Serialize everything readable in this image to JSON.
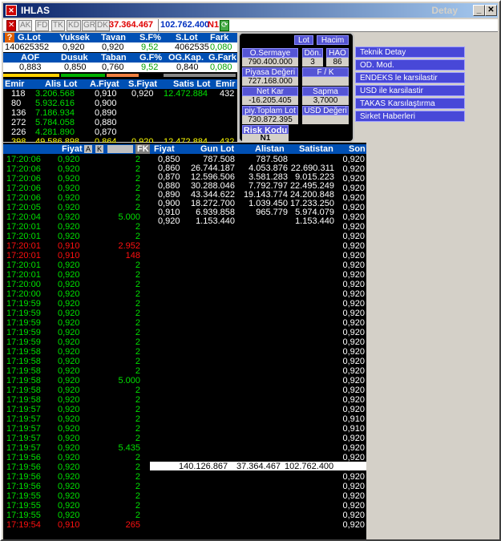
{
  "window": {
    "title": "IHLAS",
    "title_right": "Detay"
  },
  "toolbar": {
    "tabs": [
      "AK",
      "FD",
      "TK",
      "KD",
      "GR",
      "DK"
    ],
    "price1": "37.364.467",
    "price2": "102.762.400",
    "n1": "N1"
  },
  "summary": {
    "headers1": [
      "G.Lot",
      "Yuksek",
      "Tavan",
      "S.F%",
      "S.Lot",
      "Fark"
    ],
    "values1": [
      "140625352",
      "0,920",
      "0,920",
      "9,52",
      "4062535",
      "0,080"
    ],
    "headers2": [
      "AOF",
      "Dusuk",
      "Taban",
      "G.F%",
      "OG.Kap.",
      "G.Fark"
    ],
    "values2": [
      "0,883",
      "0,850",
      "0,760",
      "9,52",
      "0,840",
      "0,080"
    ]
  },
  "depth": {
    "headers": [
      "Emir",
      "Alis Lot",
      "A.Fiyat",
      "S.Fiyat",
      "Satis Lot",
      "Emir"
    ],
    "rows": [
      {
        "emir": "118",
        "alis": "3.206.568",
        "afiyat": "0,910",
        "sfiyat": "0,920",
        "satis": "12.472.884",
        "emir2": "432"
      },
      {
        "emir": "80",
        "alis": "5.932.616",
        "afiyat": "0,900",
        "sfiyat": "",
        "satis": "",
        "emir2": ""
      },
      {
        "emir": "136",
        "alis": "7.186.934",
        "afiyat": "0,890",
        "sfiyat": "",
        "satis": "",
        "emir2": ""
      },
      {
        "emir": "272",
        "alis": "5.784.058",
        "afiyat": "0,880",
        "sfiyat": "",
        "satis": "",
        "emir2": ""
      },
      {
        "emir": "226",
        "alis": "4.281.890",
        "afiyat": "0,870",
        "sfiyat": "",
        "satis": "",
        "emir2": ""
      }
    ],
    "total": {
      "emir": "398",
      "alis": "49.586.898",
      "afiyat": "0,864",
      "sfiyat": "0,920",
      "satis": "12.472.884",
      "emir2": "432"
    }
  },
  "popup": {
    "lot_label": "Lot",
    "hacim_label": "Hacim",
    "osermaye_label": "O.Sermaye",
    "osermaye_value": "790.400.000",
    "don_label": "Dön.",
    "don_value": "3",
    "hao_label": "HAO",
    "hao_value": "86",
    "piyasa_label": "Piyasa Değeri",
    "piyasa_value": "727.168.000",
    "fk_label": "F / K",
    "fk_value": "",
    "netkar_label": "Net Kar",
    "netkar_value": "-16.205.405",
    "sapma_label": "Sapma",
    "sapma_value": "3,7000",
    "pty_label": "piy.Toplam Lot",
    "pty_value": "730.872.395",
    "usd_label": "USD Değeri",
    "risk_label": "Risk Kodu",
    "risk_value": "N1"
  },
  "menu": [
    "Teknik Detay",
    "OD. Mod.",
    "ENDEKS le karsilastir",
    "USD ile karsilastir",
    "TAKAS Karsılaştırma",
    "Sirket Haberleri"
  ],
  "trades_header": {
    "fiyat": "Fiyat",
    "a": "A",
    "k": "K",
    "fk": "FK"
  },
  "trades": [
    [
      "17:20:06",
      "0,920",
      "2",
      "g"
    ],
    [
      "17:20:06",
      "0,920",
      "2",
      "g"
    ],
    [
      "17:20:06",
      "0,920",
      "2",
      "g"
    ],
    [
      "17:20:06",
      "0,920",
      "2",
      "g"
    ],
    [
      "17:20:06",
      "0,920",
      "2",
      "g"
    ],
    [
      "17:20:05",
      "0,920",
      "2",
      "g"
    ],
    [
      "17:20:04",
      "0,920",
      "5.000",
      "g"
    ],
    [
      "17:20:01",
      "0,920",
      "2",
      "g"
    ],
    [
      "17:20:01",
      "0,920",
      "2",
      "g"
    ],
    [
      "17:20:01",
      "0,910",
      "2.952",
      "r"
    ],
    [
      "17:20:01",
      "0,910",
      "148",
      "r"
    ],
    [
      "17:20:01",
      "0,920",
      "2",
      "g"
    ],
    [
      "17:20:01",
      "0,920",
      "2",
      "g"
    ],
    [
      "17:20:00",
      "0,920",
      "2",
      "g"
    ],
    [
      "17:20:00",
      "0,920",
      "2",
      "g"
    ],
    [
      "17:19:59",
      "0,920",
      "2",
      "g"
    ],
    [
      "17:19:59",
      "0,920",
      "2",
      "g"
    ],
    [
      "17:19:59",
      "0,920",
      "2",
      "g"
    ],
    [
      "17:19:59",
      "0,920",
      "2",
      "g"
    ],
    [
      "17:19:59",
      "0,920",
      "2",
      "g"
    ],
    [
      "17:19:58",
      "0,920",
      "2",
      "g"
    ],
    [
      "17:19:58",
      "0,920",
      "2",
      "g"
    ],
    [
      "17:19:58",
      "0,920",
      "2",
      "g"
    ],
    [
      "17:19:58",
      "0,920",
      "5.000",
      "g"
    ],
    [
      "17:19:58",
      "0,920",
      "2",
      "g"
    ],
    [
      "17:19:58",
      "0,920",
      "2",
      "g"
    ],
    [
      "17:19:57",
      "0,920",
      "2",
      "g"
    ],
    [
      "17:19:57",
      "0,920",
      "2",
      "g"
    ],
    [
      "17:19:57",
      "0,920",
      "2",
      "g"
    ],
    [
      "17:19:57",
      "0,920",
      "2",
      "g"
    ],
    [
      "17:19:57",
      "0,920",
      "5.435",
      "g"
    ],
    [
      "17:19:56",
      "0,920",
      "2",
      "g"
    ],
    [
      "17:19:56",
      "0,920",
      "2",
      "g"
    ],
    [
      "17:19:56",
      "0,920",
      "2",
      "g"
    ],
    [
      "17:19:56",
      "0,920",
      "2",
      "g"
    ],
    [
      "17:19:55",
      "0,920",
      "2",
      "g"
    ],
    [
      "17:19:55",
      "0,920",
      "2",
      "g"
    ],
    [
      "17:19:55",
      "0,920",
      "2",
      "g"
    ],
    [
      "17:19:54",
      "0,910",
      "265",
      "r"
    ]
  ],
  "dist_header": [
    "Fiyat",
    "Gun Lot",
    "Alistan",
    "Satistan",
    "Son"
  ],
  "dist_rows": [
    [
      "0,850",
      "787.508",
      "787.508",
      ""
    ],
    [
      "0,860",
      "26.744.187",
      "4.053.876",
      "22.690.311"
    ],
    [
      "0,870",
      "12.596.506",
      "3.581.283",
      "9.015.223"
    ],
    [
      "0,880",
      "30.288.046",
      "7.792.797",
      "22.495.249"
    ],
    [
      "0,890",
      "43.344.622",
      "19.143.774",
      "24.200.848"
    ],
    [
      "0,900",
      "18.272.700",
      "1.039.450",
      "17.233.250"
    ],
    [
      "0,910",
      "6.939.858",
      "965.779",
      "5.974.079"
    ],
    [
      "0,920",
      "1.153.440",
      "",
      "1.153.440"
    ]
  ],
  "dist_total": {
    "gun": "140.126.867",
    "alis": "37.364.467",
    "satis": "102.762.400"
  },
  "son_values": [
    "0,920",
    "0,920",
    "0,920",
    "0,920",
    "0,920",
    "0,920",
    "0,920",
    "0,920",
    "0,920",
    "0,920",
    "0,920",
    "0,920",
    "0,920",
    "0,920",
    "0,920",
    "0,920",
    "0,920",
    "0,920",
    "0,920",
    "0,920",
    "0,920",
    "0,920",
    "0,920",
    "0,920",
    "0,920",
    "0,920",
    "0,920",
    "0,910",
    "0,910",
    "0,920",
    "0,920",
    "0,920",
    "0,920",
    "0,920",
    "0,920",
    "0,920",
    "0,920",
    "0,920",
    "0,920"
  ],
  "colors": {
    "green": "#00e000",
    "red": "#ff1010",
    "yellow": "#ffff00",
    "header_blue": "#0050b4"
  }
}
